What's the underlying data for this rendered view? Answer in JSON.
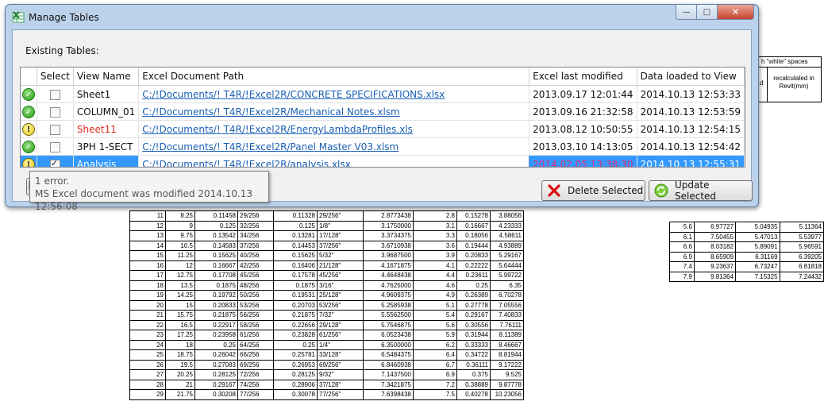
{
  "window": {
    "title": "Manage Tables",
    "close_glyph": "✕",
    "max_glyph": "□",
    "min_glyph": "—"
  },
  "existing_label": "Existing Tables:",
  "columns": [
    "",
    "Select",
    "View Name",
    "Excel Document Path",
    "Excel last modified",
    "Data loaded to View"
  ],
  "rows": [
    {
      "status": "ok",
      "selected": false,
      "view": "Sheet1",
      "path": "C:/!Documents/! T4R/!Excel2R/CONCRETE SPECIFICATIONS.xlsx",
      "modified": "2013.09.17 12:01:44",
      "loaded": "2014.10.13 12:53:33"
    },
    {
      "status": "ok",
      "selected": false,
      "view": "COLUMN_01",
      "path": "C:/!Documents/! T4R/!Excel2R/Mechanical Notes.xlsm",
      "modified": "2013.09.16 21:32:58",
      "loaded": "2014.10.13 12:53:59"
    },
    {
      "status": "warn",
      "selected": false,
      "view": "Sheet11",
      "path": "C:/!Documents/! T4R/!Excel2R/EnergyLambdaProfiles.xls",
      "modified": "2013.08.12 10:50:55",
      "loaded": "2014.10.13 12:54:15"
    },
    {
      "status": "ok",
      "selected": false,
      "view": "3PH 1-SECT",
      "path": "C:/!Documents/! T4R/!Excel2R/Panel Master V03.xlsm",
      "modified": "2013.03.10 14:13:05",
      "loaded": "2014.10.13 12:54:42"
    },
    {
      "status": "warn",
      "selected": true,
      "view": "Analysis",
      "path": "C:/!Documents/! T4R/!Excel2R/analysis.xlsx",
      "modified": "2014.02.05 13:38:30",
      "loaded": "2014.10.13 12:55:31"
    }
  ],
  "tooltip": {
    "line1": "1 error.",
    "line2": "MS Excel document was modified 2014.10.13 12:56:08"
  },
  "buttons": {
    "delete": "Delete Selected",
    "update": "Update Selected"
  },
  "colors": {
    "selection": "#3399ff",
    "link": "#1a5fb4",
    "error_text": "#e02b20",
    "modified_alert": "#e03070"
  },
  "icons": {
    "status_ok": "check-circle-icon",
    "status_warn": "exclamation-circle-icon",
    "delete": "red-x-icon",
    "update": "green-refresh-icon"
  },
  "background_sheet": {
    "header_text": "h \"white\" spaces",
    "header_d": "d",
    "header_recalc": "recalculated in Revit(mm)",
    "rows": [
      [
        "11",
        "8.25",
        "0.11458",
        "29/256",
        "0.11328",
        "29/256\"",
        "2.8773438",
        "2.8",
        "0.15278",
        "3.88056"
      ],
      [
        "12",
        "9",
        "0.125",
        "32/256",
        "0.125",
        "1/8\"",
        "3.1750000",
        "3.1",
        "0.16667",
        "4.23333"
      ],
      [
        "13",
        "9.75",
        "0.13542",
        "34/256",
        "0.13281",
        "17/128\"",
        "3.3734375",
        "3.3",
        "0.18056",
        "4.58611"
      ],
      [
        "14",
        "10.5",
        "0.14583",
        "37/256",
        "0.14453",
        "37/256\"",
        "3.6710938",
        "3.6",
        "0.19444",
        "4.93889"
      ],
      [
        "15",
        "11.25",
        "0.15625",
        "40/256",
        "0.15625",
        "5/32\"",
        "3.9687500",
        "3.9",
        "0.20833",
        "5.29167"
      ],
      [
        "16",
        "12",
        "0.16667",
        "42/256",
        "0.16406",
        "21/128\"",
        "4.1671875",
        "4.1",
        "0.22222",
        "5.64444"
      ],
      [
        "17",
        "12.75",
        "0.17708",
        "45/256",
        "0.17578",
        "45/256\"",
        "4.4648438",
        "4.4",
        "0.23611",
        "5.99722"
      ],
      [
        "18",
        "13.5",
        "0.1875",
        "48/256",
        "0.1875",
        "3/16\"",
        "4.7625000",
        "4.6",
        "0.25",
        "6.35"
      ],
      [
        "19",
        "14.25",
        "0.19792",
        "50/256",
        "0.19531",
        "25/128\"",
        "4.9609375",
        "4.9",
        "0.26389",
        "6.70278"
      ],
      [
        "20",
        "15",
        "0.20833",
        "53/256",
        "0.20703",
        "53/256\"",
        "5.2585938",
        "5.1",
        "0.27778",
        "7.05556"
      ],
      [
        "21",
        "15.75",
        "0.21875",
        "56/256",
        "0.21875",
        "7/32\"",
        "5.5562500",
        "5.4",
        "0.29167",
        "7.40833"
      ],
      [
        "22",
        "16.5",
        "0.22917",
        "58/256",
        "0.22656",
        "29/128\"",
        "5.7546875",
        "5.6",
        "0.30556",
        "7.76111"
      ],
      [
        "23",
        "17.25",
        "0.23958",
        "61/256",
        "0.23828",
        "61/256\"",
        "6.0523438",
        "5.9",
        "0.31944",
        "8.11389"
      ],
      [
        "24",
        "18",
        "0.25",
        "64/256",
        "0.25",
        "1/4\"",
        "6.3500000",
        "6.2",
        "0.33333",
        "8.46667"
      ],
      [
        "25",
        "18.75",
        "0.26042",
        "66/256",
        "0.25781",
        "33/128\"",
        "6.5484375",
        "6.4",
        "0.34722",
        "8.81944"
      ],
      [
        "26",
        "19.5",
        "0.27083",
        "69/256",
        "0.26953",
        "69/256\"",
        "6.8460938",
        "6.7",
        "0.36111",
        "9.17222"
      ],
      [
        "27",
        "20.25",
        "0.28125",
        "72/256",
        "0.28125",
        "9/32\"",
        "7.1437500",
        "6.9",
        "0.375",
        "9.525"
      ],
      [
        "28",
        "21",
        "0.29167",
        "74/256",
        "0.28906",
        "37/128\"",
        "7.3421875",
        "7.2",
        "0.38889",
        "9.87778"
      ],
      [
        "29",
        "21.75",
        "0.30208",
        "77/256",
        "0.30078",
        "77/256\"",
        "7.6398438",
        "7.5",
        "0.40278",
        "10.23056"
      ]
    ],
    "right_rows": [
      [
        "5.6",
        "6.97727",
        "5.04935",
        "5.11364"
      ],
      [
        "6.1",
        "7.50455",
        "5.47013",
        "5.53977"
      ],
      [
        "6.6",
        "8.03182",
        "5.89091",
        "5.96591"
      ],
      [
        "6.9",
        "8.65909",
        "6.31169",
        "6.39205"
      ],
      [
        "7.4",
        "9.23637",
        "6.73247",
        "6.81818"
      ],
      [
        "7.9",
        "9.81364",
        "7.15325",
        "7.24432"
      ]
    ]
  }
}
